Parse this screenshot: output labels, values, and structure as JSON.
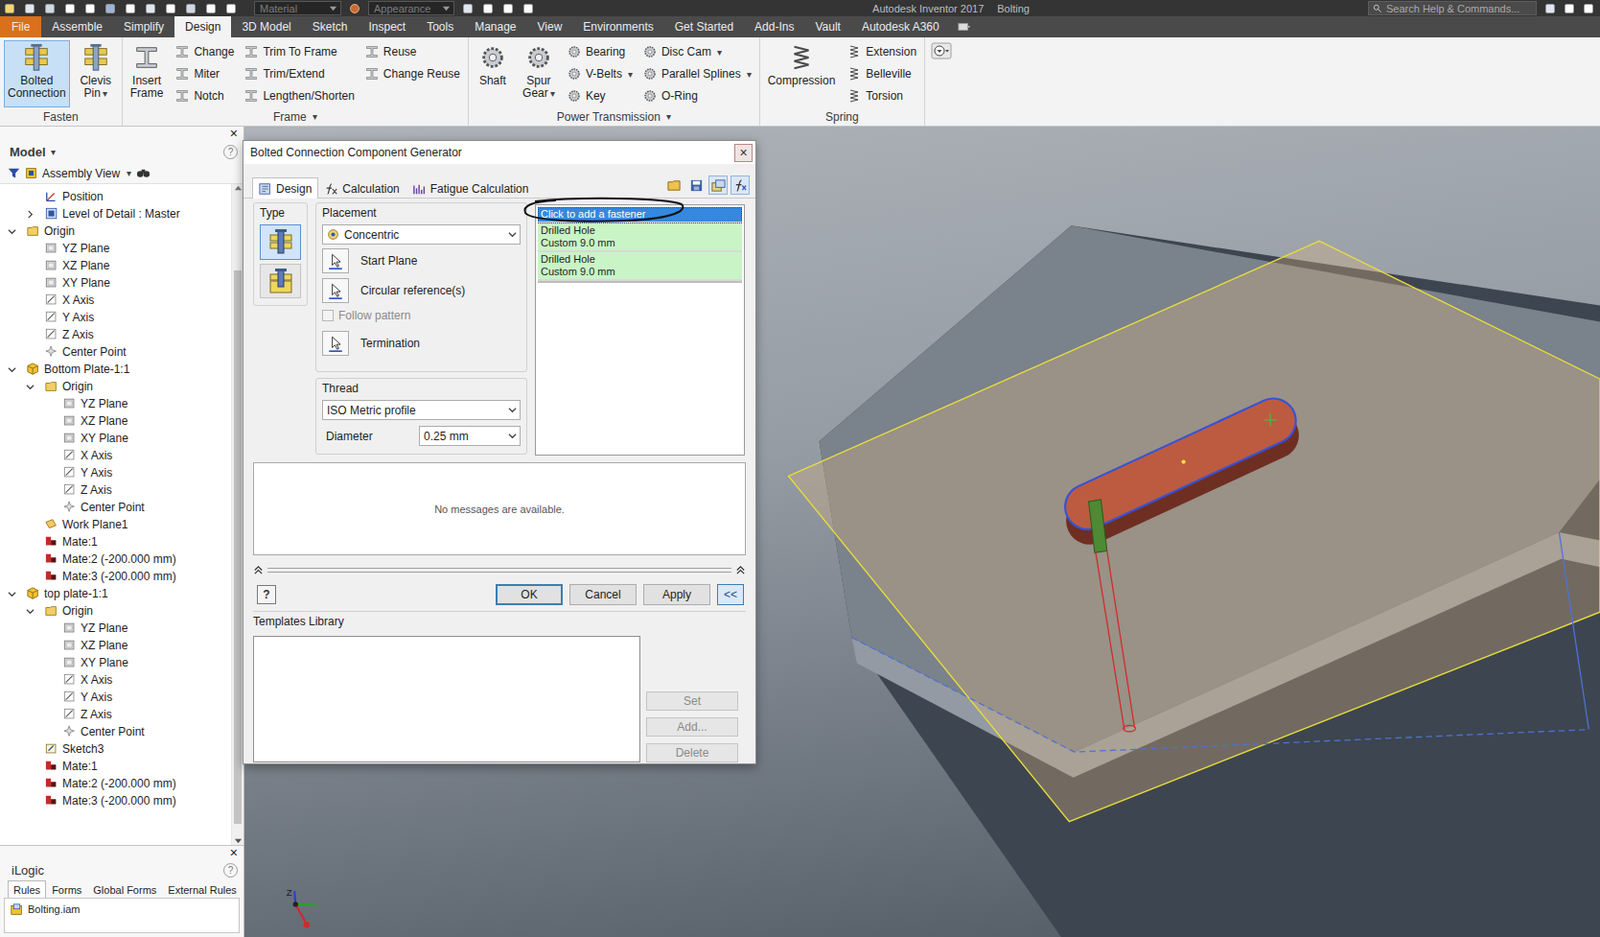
{
  "titlebar": {
    "app": "Autodesk Inventor 2017",
    "document": "Bolting",
    "material": "Material",
    "appearance": "Appearance",
    "search": "Search Help & Commands..."
  },
  "ribbon_tabs": [
    {
      "label": "File",
      "selected": false,
      "kind": "file"
    },
    {
      "label": "Assemble",
      "selected": false,
      "kind": "tab"
    },
    {
      "label": "Simplify",
      "selected": false,
      "kind": "tab"
    },
    {
      "label": "Design",
      "selected": true,
      "kind": "tab"
    },
    {
      "label": "3D Model",
      "selected": false,
      "kind": "tab"
    },
    {
      "label": "Sketch",
      "selected": false,
      "kind": "tab"
    },
    {
      "label": "Inspect",
      "selected": false,
      "kind": "tab"
    },
    {
      "label": "Tools",
      "selected": false,
      "kind": "tab"
    },
    {
      "label": "Manage",
      "selected": false,
      "kind": "tab"
    },
    {
      "label": "View",
      "selected": false,
      "kind": "tab"
    },
    {
      "label": "Environments",
      "selected": false,
      "kind": "tab"
    },
    {
      "label": "Get Started",
      "selected": false,
      "kind": "tab"
    },
    {
      "label": "Add-Ins",
      "selected": false,
      "kind": "tab"
    },
    {
      "label": "Vault",
      "selected": false,
      "kind": "tab"
    },
    {
      "label": "Autodesk A360",
      "selected": false,
      "kind": "tab"
    }
  ],
  "ribbon": {
    "arrow": "▾",
    "panels": [
      {
        "label": "Fasten",
        "menu": false,
        "kind": "bolt",
        "large": [
          {
            "lines": [
              "Bolted",
              "Connection"
            ],
            "selected": true,
            "dropdown": false
          },
          {
            "lines": [
              "Clevis",
              "Pin"
            ],
            "selected": false,
            "dropdown": true
          }
        ],
        "columns": []
      },
      {
        "label": "Frame",
        "menu": true,
        "kind": "frame",
        "large": [
          {
            "lines": [
              "Insert",
              "Frame"
            ],
            "selected": false,
            "dropdown": false
          }
        ],
        "columns": [
          [
            {
              "label": "Change",
              "dropdown": false
            },
            {
              "label": "Miter",
              "dropdown": false
            },
            {
              "label": "Notch",
              "dropdown": false
            }
          ],
          [
            {
              "label": "Trim To Frame",
              "dropdown": false
            },
            {
              "label": "Trim/Extend",
              "dropdown": false
            },
            {
              "label": "Lengthen/Shorten",
              "dropdown": false
            }
          ],
          [
            {
              "label": "Reuse",
              "dropdown": false
            },
            {
              "label": "Change Reuse",
              "dropdown": false
            }
          ]
        ]
      },
      {
        "label": "Power Transmission",
        "menu": true,
        "kind": "gear",
        "large": [
          {
            "lines": [
              "Shaft"
            ],
            "selected": false,
            "dropdown": false
          },
          {
            "lines": [
              "Spur",
              "Gear"
            ],
            "selected": false,
            "dropdown": true
          }
        ],
        "columns": [
          [
            {
              "label": "Bearing",
              "dropdown": false
            },
            {
              "label": "V-Belts",
              "dropdown": true
            },
            {
              "label": "Key",
              "dropdown": false
            }
          ],
          [
            {
              "label": "Disc Cam",
              "dropdown": true
            },
            {
              "label": "Parallel Splines",
              "dropdown": true
            },
            {
              "label": "O-Ring",
              "dropdown": false
            }
          ]
        ]
      },
      {
        "label": "Spring",
        "menu": false,
        "kind": "spring",
        "large": [
          {
            "lines": [
              "Compression"
            ],
            "selected": false,
            "dropdown": false
          }
        ],
        "columns": [
          [
            {
              "label": "Extension",
              "dropdown": false
            },
            {
              "label": "Belleville",
              "dropdown": false
            },
            {
              "label": "Torsion",
              "dropdown": false
            }
          ]
        ]
      }
    ]
  },
  "browser": {
    "close": "×",
    "title": "Model",
    "arrow": "▾",
    "help": "?",
    "view": "Assembly View",
    "scroll": {
      "start": 0.12,
      "level": 0.86
    },
    "tree": [
      {
        "label": "Position",
        "level": 1,
        "kind": "position",
        "expandable": false,
        "expanded": false
      },
      {
        "label": "Level of Detail : Master",
        "level": 1,
        "kind": "lod",
        "expandable": true,
        "expanded": false
      },
      {
        "label": "Origin",
        "level": 0,
        "kind": "folder",
        "expandable": true,
        "expanded": true
      },
      {
        "label": "YZ Plane",
        "level": 1,
        "kind": "plane",
        "expandable": false,
        "expanded": false
      },
      {
        "label": "XZ Plane",
        "level": 1,
        "kind": "plane",
        "expandable": false,
        "expanded": false
      },
      {
        "label": "XY Plane",
        "level": 1,
        "kind": "plane",
        "expandable": false,
        "expanded": false
      },
      {
        "label": "X Axis",
        "level": 1,
        "kind": "axis",
        "expandable": false,
        "expanded": false
      },
      {
        "label": "Y Axis",
        "level": 1,
        "kind": "axis",
        "expandable": false,
        "expanded": false
      },
      {
        "label": "Z Axis",
        "level": 1,
        "kind": "axis",
        "expandable": false,
        "expanded": false
      },
      {
        "label": "Center Point",
        "level": 1,
        "kind": "point",
        "expandable": false,
        "expanded": false
      },
      {
        "label": "Bottom Plate-1:1",
        "level": 0,
        "kind": "part",
        "expandable": true,
        "expanded": true
      },
      {
        "label": "Origin",
        "level": 1,
        "kind": "folder",
        "expandable": true,
        "expanded": true
      },
      {
        "label": "YZ Plane",
        "level": 2,
        "kind": "plane",
        "expandable": false,
        "expanded": false
      },
      {
        "label": "XZ Plane",
        "level": 2,
        "kind": "plane",
        "expandable": false,
        "expanded": false
      },
      {
        "label": "XY Plane",
        "level": 2,
        "kind": "plane",
        "expandable": false,
        "expanded": false
      },
      {
        "label": "X Axis",
        "level": 2,
        "kind": "axis",
        "expandable": false,
        "expanded": false
      },
      {
        "label": "Y Axis",
        "level": 2,
        "kind": "axis",
        "expandable": false,
        "expanded": false
      },
      {
        "label": "Z Axis",
        "level": 2,
        "kind": "axis",
        "expandable": false,
        "expanded": false
      },
      {
        "label": "Center Point",
        "level": 2,
        "kind": "point",
        "expandable": false,
        "expanded": false
      },
      {
        "label": "Work Plane1",
        "level": 1,
        "kind": "workplane",
        "expandable": false,
        "expanded": false
      },
      {
        "label": "Mate:1",
        "level": 1,
        "kind": "mate",
        "expandable": false,
        "expanded": false
      },
      {
        "label": "Mate:2 (-200.000 mm)",
        "level": 1,
        "kind": "mate",
        "expandable": false,
        "expanded": false
      },
      {
        "label": "Mate:3 (-200.000 mm)",
        "level": 1,
        "kind": "mate",
        "expandable": false,
        "expanded": false
      },
      {
        "label": "top plate-1:1",
        "level": 0,
        "kind": "part",
        "expandable": true,
        "expanded": true
      },
      {
        "label": "Origin",
        "level": 1,
        "kind": "folder",
        "expandable": true,
        "expanded": true
      },
      {
        "label": "YZ Plane",
        "level": 2,
        "kind": "plane",
        "expandable": false,
        "expanded": false
      },
      {
        "label": "XZ Plane",
        "level": 2,
        "kind": "plane",
        "expandable": false,
        "expanded": false
      },
      {
        "label": "XY Plane",
        "level": 2,
        "kind": "plane",
        "expandable": false,
        "expanded": false
      },
      {
        "label": "X Axis",
        "level": 2,
        "kind": "axis",
        "expandable": false,
        "expanded": false
      },
      {
        "label": "Y Axis",
        "level": 2,
        "kind": "axis",
        "expandable": false,
        "expanded": false
      },
      {
        "label": "Z Axis",
        "level": 2,
        "kind": "axis",
        "expandable": false,
        "expanded": false
      },
      {
        "label": "Center Point",
        "level": 2,
        "kind": "point",
        "expandable": false,
        "expanded": false
      },
      {
        "label": "Sketch3",
        "level": 1,
        "kind": "sketch",
        "expandable": false,
        "expanded": false
      },
      {
        "label": "Mate:1",
        "level": 1,
        "kind": "mate",
        "expandable": false,
        "expanded": false
      },
      {
        "label": "Mate:2 (-200.000 mm)",
        "level": 1,
        "kind": "mate",
        "expandable": false,
        "expanded": false
      },
      {
        "label": "Mate:3 (-200.000 mm)",
        "level": 1,
        "kind": "mate",
        "expandable": false,
        "expanded": false
      }
    ]
  },
  "ilogic": {
    "close": "×",
    "title": "iLogic",
    "help": "?",
    "tabs": [
      {
        "label": "Rules",
        "selected": true
      },
      {
        "label": "Forms",
        "selected": false
      },
      {
        "label": "Global Forms",
        "selected": false
      },
      {
        "label": "External Rules",
        "selected": false
      }
    ],
    "items": [
      "Bolting.iam"
    ]
  },
  "dialog": {
    "title": "Bolted Connection Component Generator",
    "close": "×",
    "tabs": [
      {
        "label": "Design",
        "selected": true
      },
      {
        "label": "Calculation",
        "selected": false
      },
      {
        "label": "Fatigue Calculation",
        "selected": false
      }
    ],
    "toolbar": [
      {
        "kind": "open",
        "selected": false
      },
      {
        "kind": "save",
        "selected": false
      },
      {
        "kind": "settings",
        "selected": true
      },
      {
        "kind": "formula",
        "selected": true
      }
    ],
    "type": {
      "label": "Type",
      "options": [
        {
          "kind": "through",
          "selected": true
        },
        {
          "kind": "blind",
          "selected": false
        }
      ]
    },
    "placement": {
      "label": "Placement",
      "mode": "Concentric",
      "rows": [
        {
          "label": "Start Plane",
          "kind": "select",
          "checked": false,
          "disabled": false
        },
        {
          "label": "Circular reference(s)",
          "kind": "select",
          "checked": false,
          "disabled": false
        },
        {
          "label": "Follow pattern",
          "kind": "checkbox",
          "checked": false,
          "disabled": true
        },
        {
          "label": "Termination",
          "kind": "select",
          "checked": false,
          "disabled": false
        }
      ]
    },
    "thread": {
      "label": "Thread",
      "profile": "ISO Metric profile",
      "diameter_label": "Diameter",
      "diameter": "0.25 mm"
    },
    "fasteners": [
      {
        "lines": [
          "Click to add a fastener"
        ],
        "selected": true,
        "kind": "add"
      },
      {
        "lines": [
          "Drilled Hole",
          "Custom 9.0 mm"
        ],
        "selected": false,
        "kind": "hole"
      },
      {
        "lines": [
          "Drilled Hole",
          "Custom 9.0 mm"
        ],
        "selected": false,
        "kind": "hole"
      }
    ],
    "messages": "No messages are available.",
    "help": "?",
    "buttons": [
      {
        "label": "OK",
        "kind": "push",
        "default": true
      },
      {
        "label": "Cancel",
        "kind": "push",
        "default": false
      },
      {
        "label": "Apply",
        "kind": "push",
        "default": false
      },
      {
        "label": "<<",
        "kind": "toggle",
        "default": false
      }
    ],
    "templates": {
      "label": "Templates Library",
      "buttons": [
        {
          "label": "Set",
          "disabled": true
        },
        {
          "label": "Add...",
          "disabled": true
        },
        {
          "label": "Delete",
          "disabled": true
        }
      ]
    }
  },
  "triad": {
    "labels": [
      "Z"
    ]
  }
}
